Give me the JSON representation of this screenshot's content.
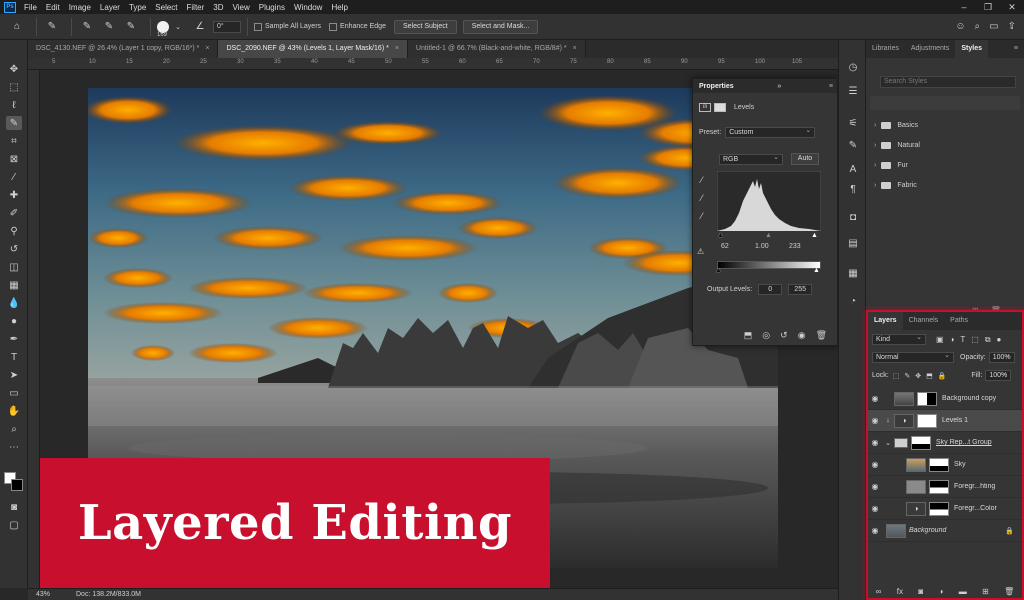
{
  "menubar": {
    "logo": "Ps",
    "items": [
      "File",
      "Edit",
      "Image",
      "Layer",
      "Type",
      "Select",
      "Filter",
      "3D",
      "View",
      "Plugins",
      "Window",
      "Help"
    ]
  },
  "options": {
    "brush_size": "169",
    "angle": "0°",
    "sample_all_layers": "Sample All Layers",
    "enhance_edge": "Enhance Edge",
    "select_subject": "Select Subject",
    "select_and_mask": "Select and Mask..."
  },
  "tabs": [
    {
      "label": "DSC_4130.NEF @ 26.4% (Layer 1 copy, RGB/16*) *",
      "close": "×"
    },
    {
      "label": "DSC_2090.NEF @ 43% (Levels 1, Layer Mask/16) *",
      "close": "×"
    },
    {
      "label": "Untitled-1 @ 66.7% (Black-and-white, RGB/8#) *",
      "close": "×"
    }
  ],
  "ruler_ticks": [
    "5",
    "10",
    "15",
    "20",
    "25",
    "30",
    "35",
    "40",
    "45",
    "50",
    "55",
    "60",
    "65",
    "70",
    "75",
    "80",
    "85",
    "90",
    "95",
    "100",
    "105"
  ],
  "properties": {
    "title": "Properties",
    "adjustment": "Levels",
    "preset_label": "Preset:",
    "preset_value": "Custom",
    "channel": "RGB",
    "auto_label": "Auto",
    "input_black": "62",
    "input_gamma": "1.00",
    "input_white": "233",
    "output_label": "Output Levels:",
    "output_black": "0",
    "output_white": "255"
  },
  "right_top": {
    "tabs": [
      "Libraries",
      "Adjustments",
      "Styles"
    ],
    "search_placeholder": "Search Styles",
    "folders": [
      "Basics",
      "Natural",
      "Fur",
      "Fabric"
    ]
  },
  "layers_panel": {
    "tabs": [
      "Layers",
      "Channels",
      "Paths"
    ],
    "kind": "Kind",
    "blend_mode": "Normal",
    "opacity_label": "Opacity:",
    "opacity": "100%",
    "lock_label": "Lock:",
    "fill_label": "Fill:",
    "fill": "100%",
    "layers": [
      {
        "name": "Background copy"
      },
      {
        "name": "Levels 1"
      },
      {
        "name": "Sky Rep...t Group"
      },
      {
        "name": "Sky"
      },
      {
        "name": "Foregr...hting"
      },
      {
        "name": "Foregr...Color"
      },
      {
        "name": "Background"
      }
    ]
  },
  "banner": {
    "text": "Layered Editing"
  },
  "status": {
    "zoom": "43%",
    "doc": "Doc: 138.2M/833.0M"
  },
  "colors": {
    "banner": "#c8102e",
    "panel": "#353535",
    "highlight": "#c8102e"
  }
}
